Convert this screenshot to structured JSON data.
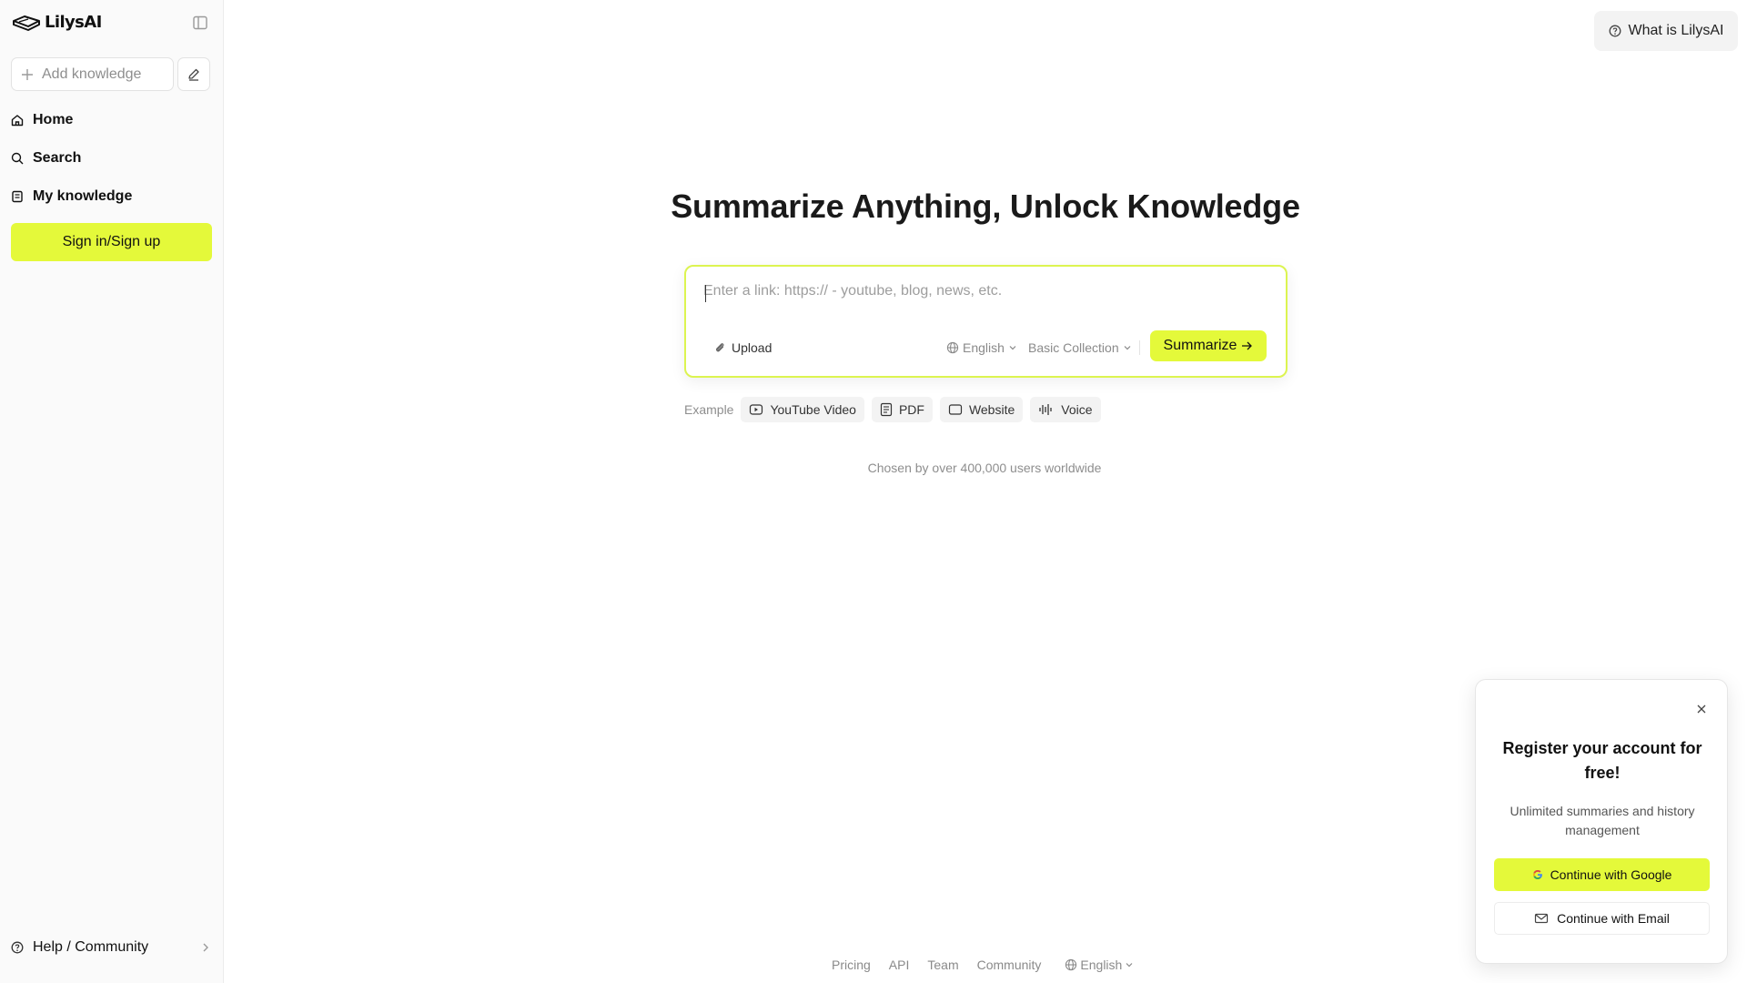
{
  "app": {
    "logo_text": "LilysAI"
  },
  "sidebar": {
    "add_knowledge_label": "Add knowledge",
    "nav": [
      {
        "label": "Home",
        "icon": "home-icon"
      },
      {
        "label": "Search",
        "icon": "search-icon"
      },
      {
        "label": "My knowledge",
        "icon": "notebook-icon"
      }
    ],
    "signin_label": "Sign in/Sign up",
    "help_label": "Help / Community"
  },
  "header": {
    "what_is_label": "What is LilysAI"
  },
  "main": {
    "headline": "Summarize Anything, Unlock Knowledge",
    "input": {
      "value": "",
      "placeholder": "Enter a link: https:// - youtube, blog, news, etc."
    },
    "upload_label": "Upload",
    "language": "English",
    "collection": "Basic Collection",
    "summarize_label": "Summarize",
    "examples_label": "Example",
    "examples": [
      {
        "label": "YouTube Video",
        "icon": "play-icon"
      },
      {
        "label": "PDF",
        "icon": "document-icon"
      },
      {
        "label": "Website",
        "icon": "browser-icon"
      },
      {
        "label": "Voice",
        "icon": "waveform-icon"
      }
    ],
    "social_proof": "Chosen by over 400,000 users worldwide"
  },
  "footer": {
    "links": [
      "Pricing",
      "API",
      "Team",
      "Community"
    ],
    "language": "English"
  },
  "popup": {
    "title": "Register your account for free!",
    "description": "Unlimited summaries and history management",
    "google_label": "Continue with Google",
    "email_label": "Continue with Email"
  },
  "colors": {
    "accent": "#e4f93a",
    "input_border": "#dcf450",
    "sidebar_bg": "#fafafa"
  }
}
